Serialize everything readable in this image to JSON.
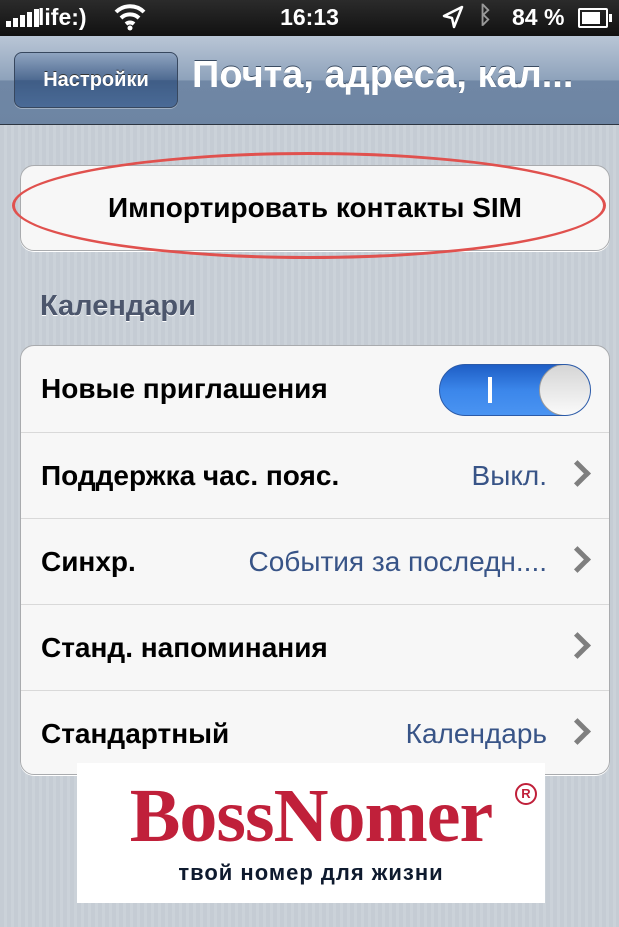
{
  "status_bar": {
    "carrier": "life:)",
    "time": "16:13",
    "battery": "84 %"
  },
  "nav": {
    "back_label": "Настройки",
    "title": "Почта, адреса, кал..."
  },
  "import_button": "Импортировать контакты SIM",
  "calendars": {
    "header": "Календари",
    "rows": [
      {
        "label": "Новые приглашения",
        "toggle": true
      },
      {
        "label": "Поддержка час. пояс.",
        "value": "Выкл."
      },
      {
        "label": "Синхр.",
        "value": "События за последн...."
      },
      {
        "label": "Станд. напоминания",
        "value": ""
      },
      {
        "label": "Стандартный",
        "value": "Календарь"
      }
    ]
  },
  "watermark": {
    "brand": "BossNomer",
    "registered": "R",
    "tagline": "твой номер для жизни"
  },
  "colors": {
    "accent_ring": "#e0514e",
    "value_text": "#385487",
    "toggle_on": "#3b86ea",
    "brand_red": "#c0203a"
  }
}
